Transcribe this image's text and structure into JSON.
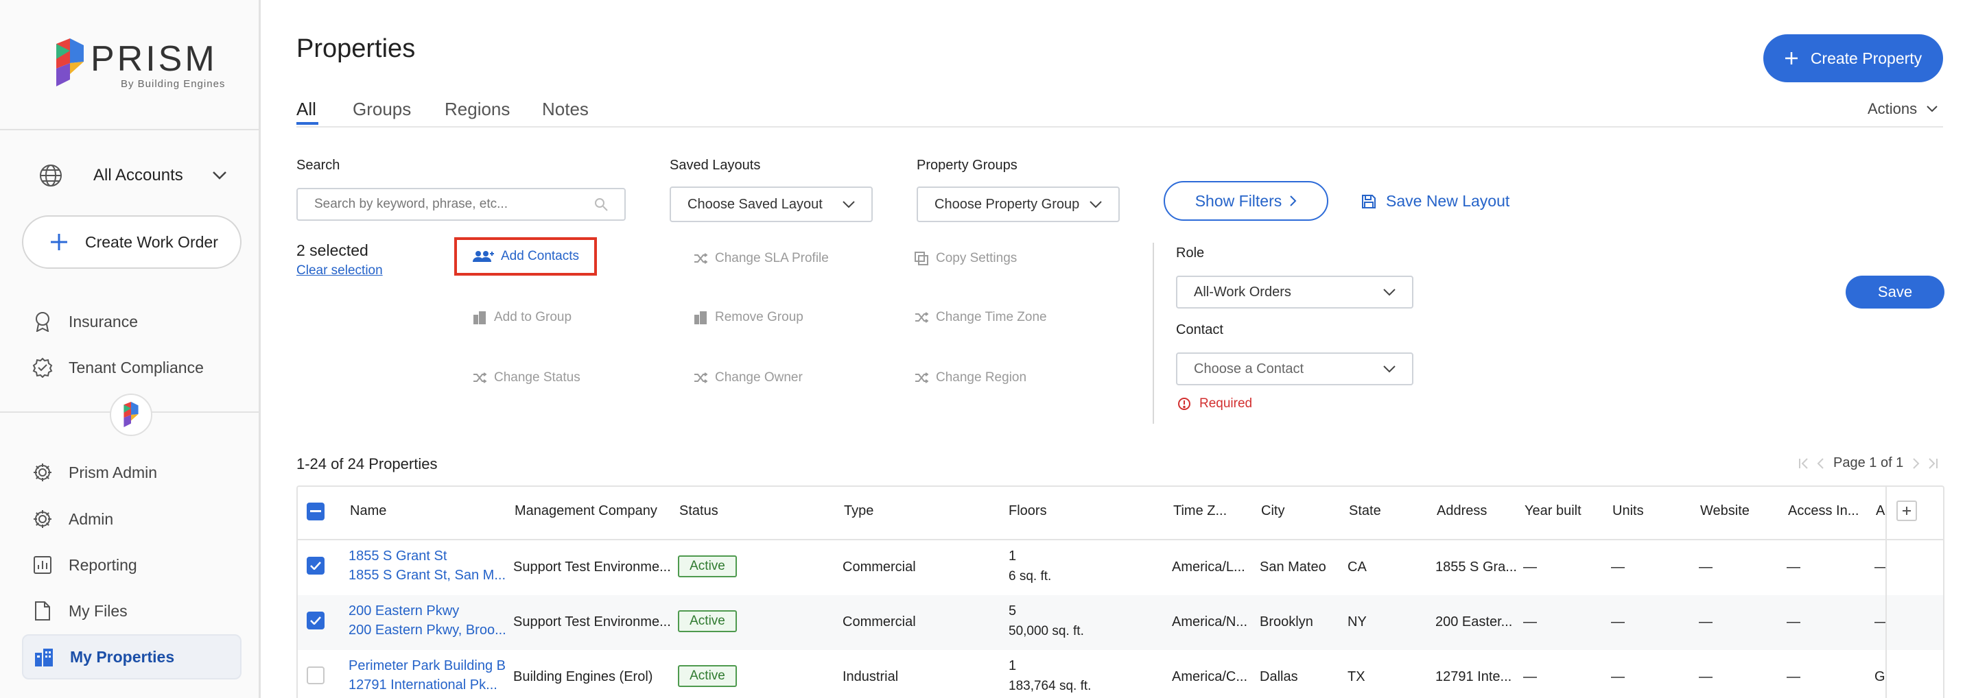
{
  "brand": {
    "name": "PRISM",
    "tagline": "By Building Engines"
  },
  "sidebar": {
    "account_selector": "All Accounts",
    "create_work_order": "Create Work Order",
    "items_top": [
      {
        "label": "Insurance",
        "icon": "insurance-icon"
      },
      {
        "label": "Tenant Compliance",
        "icon": "compliance-icon"
      }
    ],
    "items": [
      {
        "label": "Prism Admin",
        "icon": "gear-icon"
      },
      {
        "label": "Admin",
        "icon": "gear-icon"
      },
      {
        "label": "Reporting",
        "icon": "chart-icon"
      },
      {
        "label": "My Files",
        "icon": "file-icon"
      },
      {
        "label": "My Properties",
        "icon": "buildings-icon",
        "active": true
      }
    ]
  },
  "page": {
    "title": "Properties",
    "create_button": "Create Property",
    "actions": "Actions"
  },
  "tabs": [
    {
      "label": "All",
      "active": true
    },
    {
      "label": "Groups"
    },
    {
      "label": "Regions"
    },
    {
      "label": "Notes"
    }
  ],
  "filters": {
    "search_label": "Search",
    "search_placeholder": "Search by keyword, phrase, etc...",
    "saved_layouts_label": "Saved Layouts",
    "saved_layouts_value": "Choose Saved Layout",
    "property_groups_label": "Property Groups",
    "property_groups_value": "Choose Property Group",
    "show_filters": "Show Filters",
    "save_new_layout": "Save New Layout"
  },
  "selection": {
    "count_text": "2 selected",
    "clear": "Clear selection"
  },
  "bulk_actions": {
    "add_contacts": "Add Contacts",
    "change_sla": "Change SLA Profile",
    "copy_settings": "Copy Settings",
    "add_to_group": "Add to Group",
    "remove_group": "Remove Group",
    "change_time_zone": "Change Time Zone",
    "change_status": "Change Status",
    "change_owner": "Change Owner",
    "change_region": "Change Region"
  },
  "contact_panel": {
    "role_label": "Role",
    "role_value": "All-Work Orders",
    "contact_label": "Contact",
    "contact_placeholder": "Choose a Contact",
    "required": "Required",
    "save": "Save"
  },
  "results": {
    "count": "1-24 of 24 Properties",
    "page": "Page 1 of 1"
  },
  "table": {
    "columns": [
      "Name",
      "Management Company",
      "Status",
      "Type",
      "Floors",
      "Time Z...",
      "City",
      "State",
      "Address",
      "Year built",
      "Units",
      "Website",
      "Access In...",
      "Al"
    ],
    "rows": [
      {
        "checked": true,
        "name": "1855 S Grant St",
        "addr": "1855 S Grant St, San M...",
        "company": "Support Test Environme...",
        "status": "Active",
        "type": "Commercial",
        "floors": "1",
        "sqft": "6 sq. ft.",
        "tz": "America/L...",
        "city": "San Mateo",
        "state": "CA",
        "address": "1855 S Gra...",
        "year": "—",
        "units": "—",
        "website": "—",
        "access": "—",
        "al": "—"
      },
      {
        "checked": true,
        "name": "200 Eastern Pkwy",
        "addr": "200 Eastern Pkwy, Broo...",
        "company": "Support Test Environme...",
        "status": "Active",
        "type": "Commercial",
        "floors": "5",
        "sqft": "50,000 sq. ft.",
        "tz": "America/N...",
        "city": "Brooklyn",
        "state": "NY",
        "address": "200 Easter...",
        "year": "—",
        "units": "—",
        "website": "—",
        "access": "—",
        "al": "—"
      },
      {
        "checked": false,
        "name": "Perimeter Park Building B",
        "addr": "12791 International Pk...",
        "company": "Building Engines (Erol)",
        "status": "Active",
        "type": "Industrial",
        "floors": "1",
        "sqft": "183,764 sq. ft.",
        "tz": "America/C...",
        "city": "Dallas",
        "state": "TX",
        "address": "12791 Inte...",
        "year": "—",
        "units": "—",
        "website": "—",
        "access": "—",
        "al": "Go"
      }
    ]
  },
  "colors": {
    "primary": "#2d6bd8",
    "link": "#2563c9",
    "highlight": "#e03524",
    "active_badge": "#4e9a4e",
    "required": "#d23030"
  }
}
